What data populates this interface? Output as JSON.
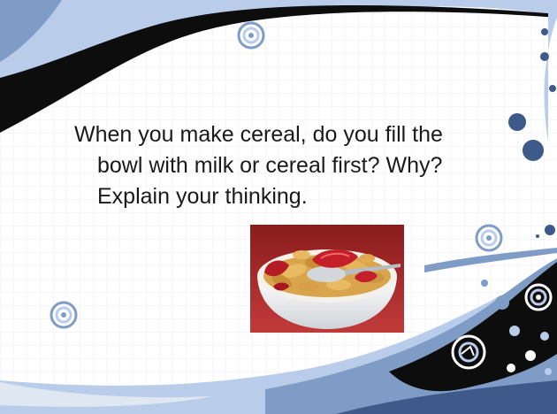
{
  "slide": {
    "question_lines": [
      "When you make cereal, do you fill the",
      "bowl with milk or cereal first?  Why?",
      "Explain your thinking."
    ]
  },
  "image": {
    "subject": "bowl of flake cereal with strawberries and milk"
  },
  "colors": {
    "background": "#ffffff",
    "light_blue": "#b9cdea",
    "mid_blue": "#7f9cc6",
    "dark_blue": "#3d5a8a",
    "black_band": "#0d0d0d",
    "text": "#1a1a1a"
  },
  "decorations": {
    "ring_icon": "concentric-rings-icon",
    "dot_icon": "blue-dot-icon"
  }
}
